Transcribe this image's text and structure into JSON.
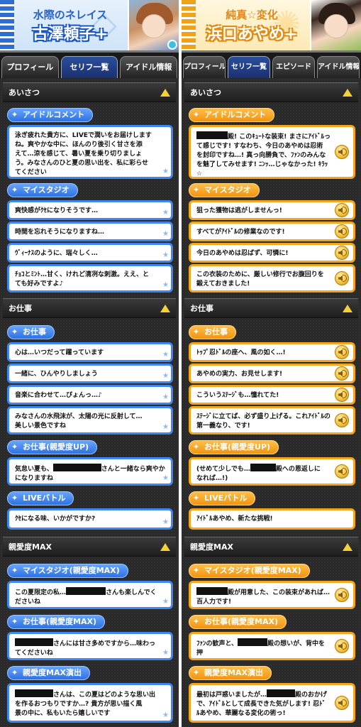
{
  "left": {
    "subtitle": "水際のネレイス",
    "title": "古澤頼子+",
    "tabs": [
      "プロフィール",
      "セリフ一覧",
      "アイドル情報"
    ],
    "active_tab": 1,
    "sections": {
      "greeting": "あいさつ",
      "work": "お仕事",
      "max": "親愛度MAX"
    },
    "labels": {
      "idol_comment": "アイドルコメント",
      "my_studio": "マイスタジオ",
      "work": "お仕事",
      "work_up": "お仕事(親愛度UP)",
      "live": "LIVEバトル",
      "my_studio_max": "マイスタジオ(親愛度MAX)",
      "work_max": "お仕事(親愛度MAX)",
      "max_show": "親愛度MAX演出"
    },
    "lines": {
      "idol_comment": "泳ぎ疲れた貴方に、LIVEで潤いをお届けします\nね。爽やかな中に、ほんのり後引く甘さを添\nえて…涼を感じて、暑い夏を乗り切りましょ\nう。みなさんのひと夏の思い出を、私に彩らせ\nてください",
      "studio1": "爽快感がｸｾになりそうです…",
      "studio2": "時間を忘れそうになりますね…",
      "studio3": "ｳﾞｨｰﾅｽのように、瑞々しく…",
      "studio4": "ﾁｮｺとﾐﾝﾄ…甘く、けれど清冽な刺激。ええ、と\nても好みですよ♪",
      "work1": "心は…いつだって躍っています",
      "work2": "一緒に、ひんやりしましょう",
      "work3": "音楽に合わせて…ぴょんっ…♪",
      "work4": "みなさんの水飛沫が、太陽の光に反射して…\n美しい景色ですね",
      "work_up_a": "気怠い夏も、",
      "work_up_b": "さんと一緒なら爽やか\nになりますね",
      "live1": "ｸｾになる味、いかがですか?",
      "studio_max_a": "この夏限定の私…",
      "studio_max_b": "さんも楽しんでく\nださいね",
      "work_max_b": "さんには甘さ多めですから…味わっ\nてくださいね",
      "max_show_b": "さんは、この夏はどのような思い出\nを作るおつもりですか…? 貴方が思い描く風\n景の中に、私もいたら嬉しいです"
    }
  },
  "right": {
    "subtitle": "純真☆変化",
    "title": "浜口あやめ+",
    "tabs": [
      "プロフィール",
      "セリフ一覧",
      "エピソード",
      "アイドル情報"
    ],
    "active_tab": 1,
    "sections": {
      "greeting": "あいさつ",
      "work": "お仕事",
      "max": "親愛度MAX"
    },
    "labels": {
      "idol_comment": "アイドルコメント",
      "my_studio": "マイスタジオ",
      "work": "お仕事",
      "work_up": "お仕事(親愛度UP)",
      "live": "LIVEバトル",
      "my_studio_max": "マイスタジオ(親愛度MAX)",
      "work_max": "お仕事(親愛度MAX)",
      "max_show": "親愛度MAX演出"
    },
    "lines": {
      "idol_comment_b": "殿! このｷｭｰﾄな装束! まさにｱｲﾄﾞﾙっ\nて感じです! すなわち、今日のあやめは忍術\nを封印ですね…! 真っ向勝負で、ﾌｧﾝのみんな\nを魅了してみせます! ﾆﾝｯ…じゃなかった! ｷﾗｯ\n☆",
      "studio1": "狙った獲物は逃がしませんっ!",
      "studio2": "すべてがｱｲﾄﾞﾙの修業なのです!",
      "studio3": "今日のあやめは忍ばず、可憐に!",
      "studio4": "この衣装のために、厳しい修行でお腹回りを\n鍛えておきました!",
      "work1": "ﾄｯﾌﾟ忍ﾄﾞﾙの座へ、風の如く…!",
      "work2": "あやめの実力、お見せします!",
      "work3": "こういうｽﾃｰｼﾞも…憧れてた!",
      "work4": "ｽﾃｰｼﾞに立てば、必ず盛り上げる。これｱｲﾄﾞﾙの\n第一義なり、です!",
      "work_up_a": "(せめて少しでも…",
      "work_up_b": "殿への恩返しに\nなれば…!)",
      "live1": "ｱｲﾄﾞﾙあやめ、新たな挑戦!",
      "studio_max_b": "殿が用意した、この装束があれば…\n百人力です!",
      "work_max_a": "ﾌｧﾝの歓声と、",
      "work_max_b": "殿の想いが、背中を押\nしてくれます!",
      "max_show_a": "最初は戸惑いましたが…",
      "max_show_b": "殿のおかげ\nで、ｱｲﾄﾞﾙとして成長できた気がします! 忍ﾄﾞ\nﾙあやめ、華麗なる変化の術っ!"
    }
  },
  "colors": {
    "left_accent": "#3f86f2",
    "right_accent": "#f3a51d",
    "panel_bg": "#2a2a2a"
  }
}
